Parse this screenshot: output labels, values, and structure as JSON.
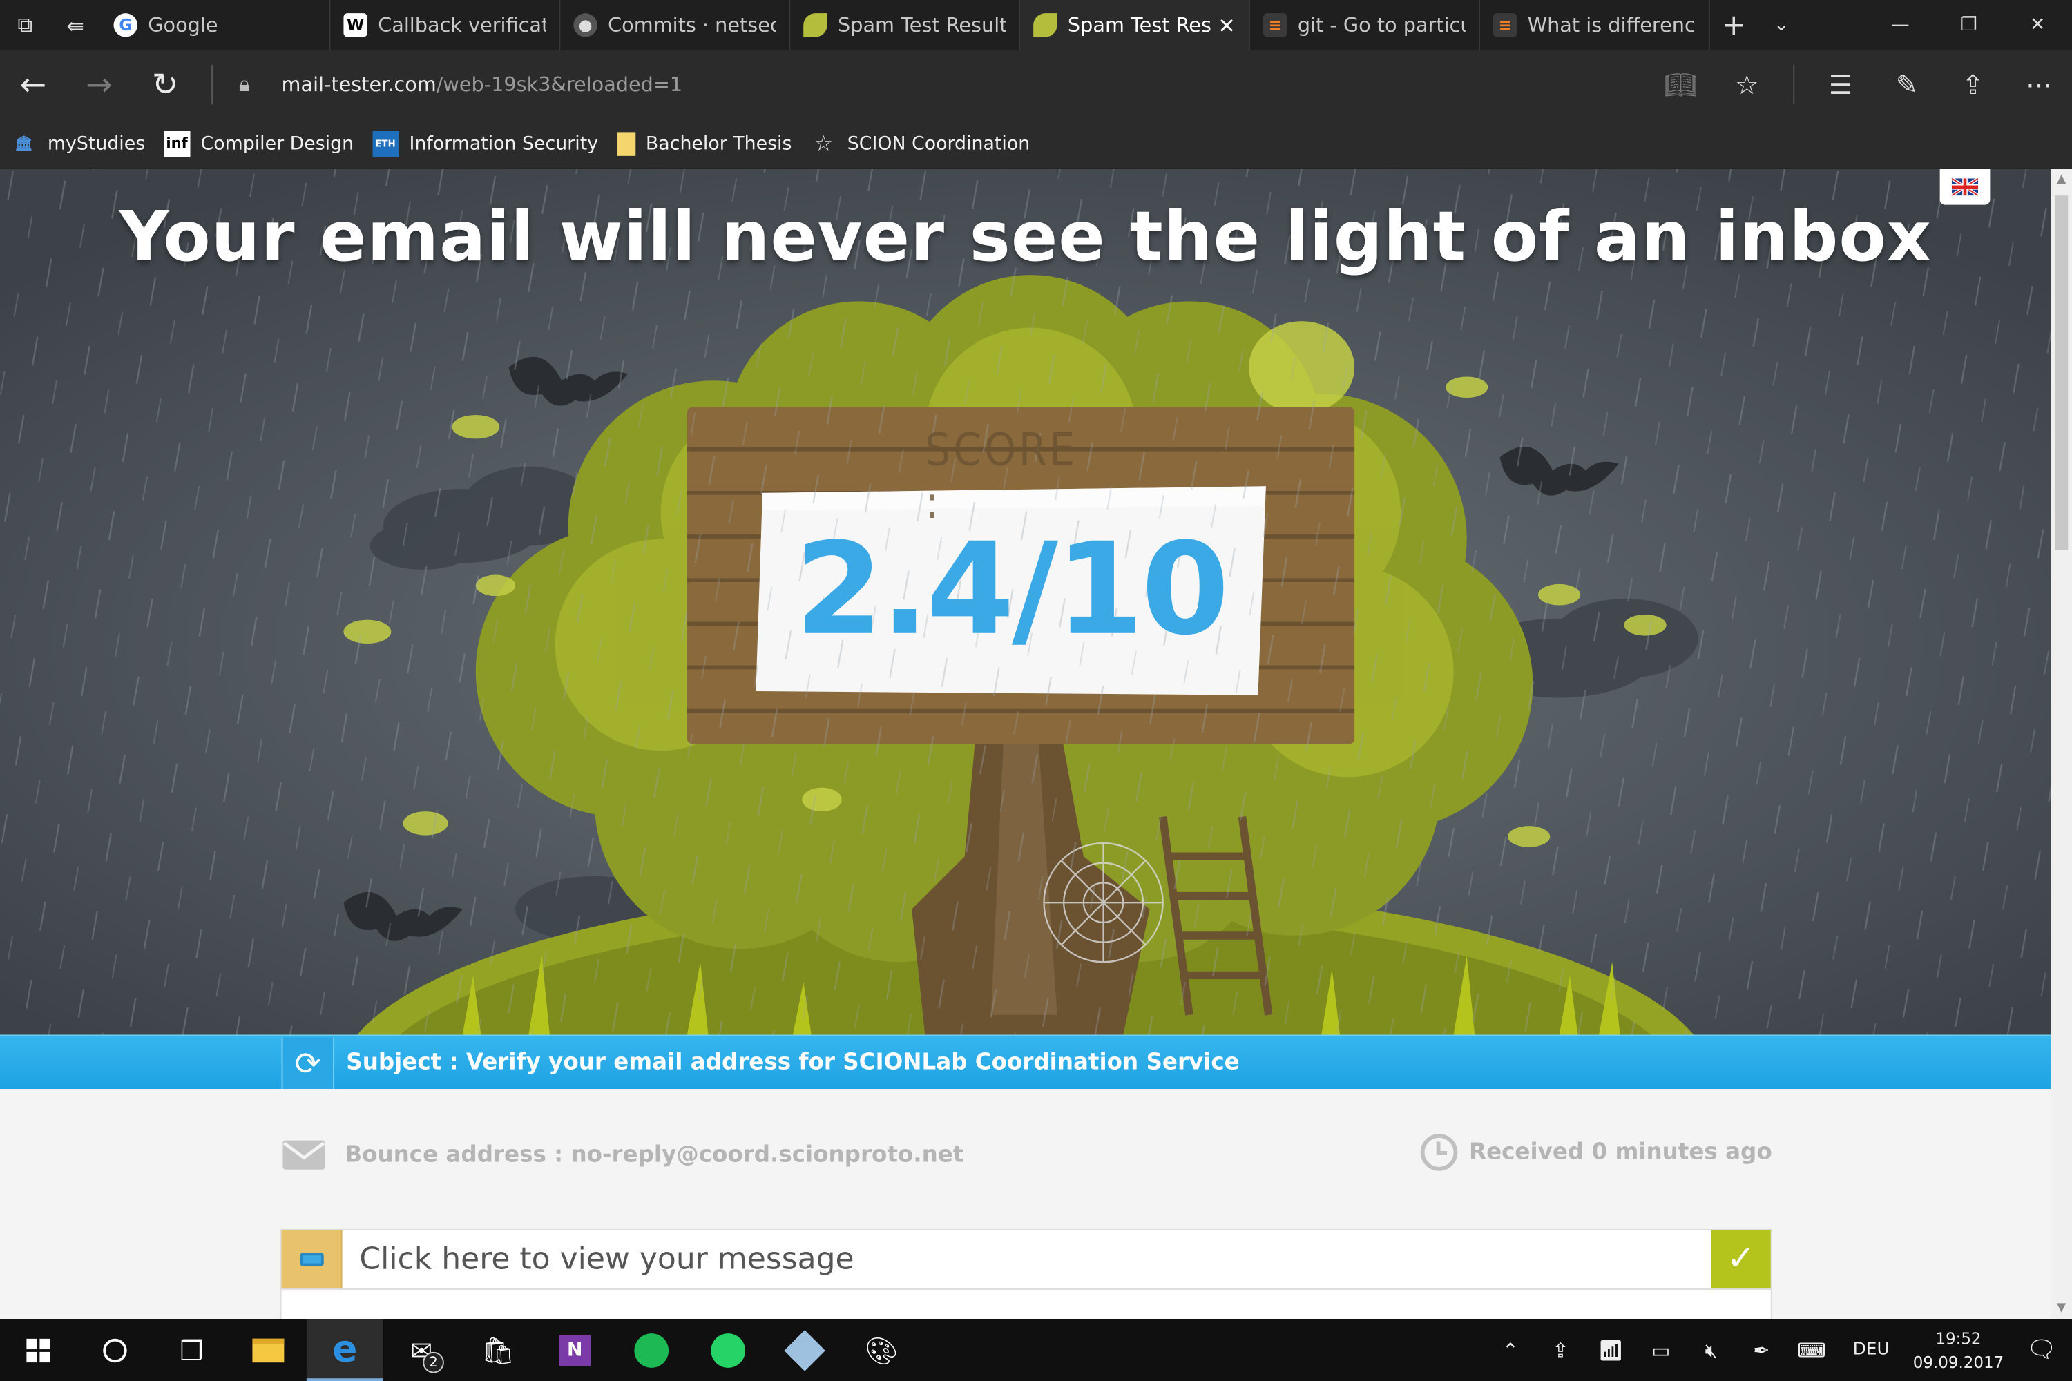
{
  "browser": {
    "tabs": [
      {
        "label": "Google",
        "favicon": "google-icon",
        "active": false
      },
      {
        "label": "Callback verificatio",
        "favicon": "wikipedia-icon",
        "active": false
      },
      {
        "label": "Commits · netsec-e",
        "favicon": "github-icon",
        "active": false
      },
      {
        "label": "Spam Test Result",
        "favicon": "leaf-icon",
        "active": false
      },
      {
        "label": "Spam Test Resı",
        "favicon": "leaf-icon",
        "active": true
      },
      {
        "label": "git - Go to particul",
        "favicon": "stackoverflow-icon",
        "active": false
      },
      {
        "label": "What is difference",
        "favicon": "stackoverflow-icon",
        "active": false
      }
    ],
    "url_domain": "mail-tester.com",
    "url_path": "/web-19sk3&reloaded=1",
    "favorites": [
      {
        "label": "myStudies",
        "icon": "eth-building-icon"
      },
      {
        "label": "Compiler Design",
        "icon": "inf-icon"
      },
      {
        "label": "Information Security",
        "icon": "eth-icon"
      },
      {
        "label": "Bachelor Thesis",
        "icon": "folder-icon"
      },
      {
        "label": "SCION Coordination",
        "icon": "star-icon"
      }
    ]
  },
  "page": {
    "headline": "Your email will never see the light of an inbox",
    "score_label": "SCORE :",
    "score_value": "2.4/10",
    "subject": "Subject : Verify your email address for SCIONLab Coordination Service",
    "bounce": "Bounce address : no-reply@coord.scionproto.net",
    "received": "Received 0 minutes ago",
    "view_message": "Click here to view your message"
  },
  "taskbar": {
    "apps": [
      "windows-start-icon",
      "cortana-icon",
      "task-view-icon",
      "file-explorer-icon",
      "edge-icon",
      "mail-icon",
      "store-icon",
      "onenote-icon",
      "spotify-icon",
      "whatsapp-icon",
      "virtualbox-icon",
      "paint-icon"
    ],
    "mail_badge": "2",
    "language": "DEU",
    "time": "19:52",
    "date": "09.09.2017"
  },
  "colors": {
    "score": "#3aa9e6",
    "subject_bar": "#1fa2e3",
    "check": "#b4c41c"
  }
}
